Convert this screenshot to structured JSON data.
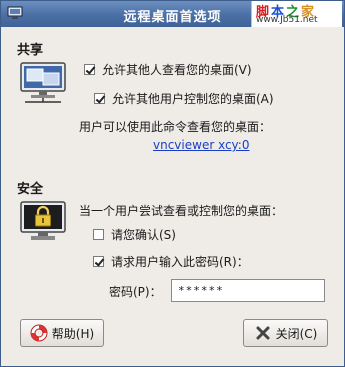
{
  "window": {
    "title": "远程桌面首选项"
  },
  "watermark": {
    "top_1": "脚",
    "top_2": "本",
    "top_3": "之",
    "top_4": "家",
    "bottom": "www.Jb51.net"
  },
  "sharing": {
    "heading": "共享",
    "allow_view_label": "允许其他人查看您的桌面(V)",
    "allow_view_checked": true,
    "allow_control_label": "允许其他用户控制您的桌面(A)",
    "allow_control_checked": true,
    "command_hint": "用户可以使用此命令查看您的桌面：",
    "command": "vncviewer xcy:0"
  },
  "security": {
    "heading": "安全",
    "intro": "当一个用户尝试查看或控制您的桌面：",
    "confirm_label": "请您确认(S)",
    "confirm_checked": false,
    "require_password_label": "请求用户输入此密码(R)：",
    "require_password_checked": true,
    "password_label": "密码(P)：",
    "password_value": "******"
  },
  "buttons": {
    "help_label": "帮助(H)",
    "close_label": "关闭(C)"
  },
  "colors": {
    "titlebar": "#4a6fa5",
    "link": "#1a3fc6",
    "dialog_bg": "#efebe7"
  },
  "icons": {
    "title": "remote-desktop-icon",
    "sharing": "monitor-network-icon",
    "security": "monitor-lock-icon",
    "help": "lifebuoy-icon",
    "close": "close-x-icon"
  }
}
